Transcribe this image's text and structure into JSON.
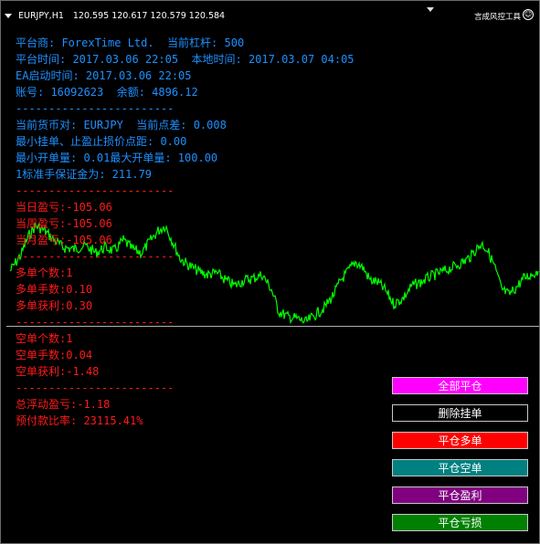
{
  "chart": {
    "title": "EURJPY,H1",
    "ohlc": "120.595 120.617 120.579 120.584",
    "ea_name": "言成风控工具"
  },
  "info": {
    "platform": "平台商: ForexTime Ltd.  当前杠杆: 500",
    "platform_time": "平台时间: 2017.03.06 22:05  本地时间: 2017.03.07 04:05",
    "ea_start": "EA启动时间: 2017.03.06 22:05",
    "account": "账号: 16092623  余额: 4896.12",
    "sep1": "------------------------",
    "pair": "当前货币对: EURJPY  当前点差: 0.008",
    "min_distance": "最小挂单、止盈止损价点距: 0.00",
    "lots": "最小开单量: 0.01最大开单量: 100.00",
    "margin": "1标准手保证金为: 211.79",
    "sep2": "------------------------",
    "day_pl": "当日盈亏:-105.06",
    "week_pl": "当周盈亏:-105.06",
    "month_pl": "当月盈亏:-105.06",
    "sep3": "------------------------",
    "long_count": "多单个数:1",
    "long_lots": "多单手数:0.10",
    "long_profit": "多单获利:0.30",
    "sep4": "------------------------",
    "short_count": "空单个数:1",
    "short_lots": "空单手数:0.04",
    "short_profit": "空单获利:-1.48",
    "sep5": "------------------------",
    "float_pl": "总浮动盈亏:-1.18",
    "margin_ratio": "预付款比率: 23115.41%"
  },
  "buttons": {
    "close_all": "全部平仓",
    "delete_pending": "删除挂单",
    "close_long": "平仓多单",
    "close_short": "平仓空单",
    "close_profit": "平仓盈利",
    "close_loss": "平仓亏损"
  },
  "colors": {
    "info_text": "#1e90ff",
    "pl_text": "#ff1a1a",
    "price_line": "#00ff00",
    "close_all_bg": "#ff00ff",
    "delete_pending_bg": "#000000",
    "close_long_bg": "#ff0000",
    "close_short_bg": "#008080",
    "close_profit_bg": "#800080",
    "close_loss_bg": "#008000"
  },
  "icons": {
    "dropdown": "triangle-down-icon",
    "expert_advisor": "smiley-icon"
  }
}
